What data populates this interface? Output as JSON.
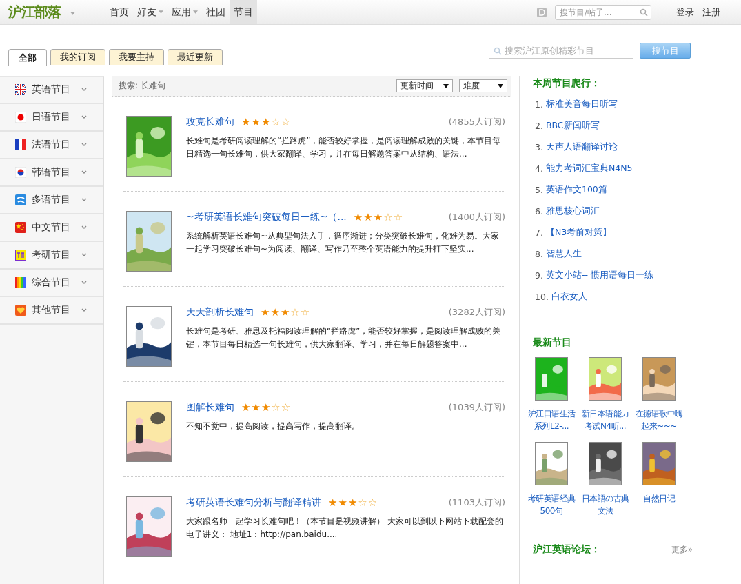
{
  "header": {
    "logo": "沪江部落",
    "nav": [
      {
        "label": "首页",
        "dropdown": false,
        "selected": false
      },
      {
        "label": "好友",
        "dropdown": true,
        "selected": false
      },
      {
        "label": "应用",
        "dropdown": true,
        "selected": false
      },
      {
        "label": "社团",
        "dropdown": false,
        "selected": false
      },
      {
        "label": "节目",
        "dropdown": false,
        "selected": true
      }
    ],
    "search": {
      "placeholder": "搜节目/帖子..."
    },
    "links": [
      "登录",
      "注册"
    ]
  },
  "tabs": [
    {
      "label": "全部",
      "selected": true
    },
    {
      "label": "我的订阅",
      "selected": false
    },
    {
      "label": "我要主持",
      "selected": false
    },
    {
      "label": "最近更新",
      "selected": false
    }
  ],
  "program_search": {
    "placeholder": "搜索沪江原创精彩节目",
    "button": "搜节目"
  },
  "sidebar": {
    "items": [
      {
        "label": "英语节目"
      },
      {
        "label": "日语节目"
      },
      {
        "label": "法语节目"
      },
      {
        "label": "韩语节目"
      },
      {
        "label": "多语节目"
      },
      {
        "label": "中文节目"
      },
      {
        "label": "考研节目"
      },
      {
        "label": "综合节目"
      },
      {
        "label": "其他节目"
      }
    ]
  },
  "results": {
    "query": "搜索: 长难句",
    "sort": "更新时间",
    "filter": "难度",
    "items": [
      {
        "title": "攻克长难句",
        "stars": 3,
        "subscribers": "(4855人订阅)",
        "description": "长难句是考研阅读理解的“拦路虎”，能否较好掌握，是阅读理解成败的关键，本节目每日精选一句长难句，供大家翻译、学习，并在每日解题答案中从结构、语法..."
      },
      {
        "title": "~考研英语长难句突破每日一练~（...",
        "stars": 3,
        "subscribers": "(1400人订阅)",
        "description": "系统解析英语长难句~从典型句法入手，循序渐进；分类突破长难句，化难为易。大家一起学习突破长难句~为阅读、翻译、写作乃至整个英语能力的提升打下坚实..."
      },
      {
        "title": "天天剖析长难句",
        "stars": 3,
        "subscribers": "(3282人订阅)",
        "description": "长难句是考研、雅思及托福阅读理解的“拦路虎”，能否较好掌握，是阅读理解成败的关键，本节目每日精选一句长难句，供大家翻译、学习，并在每日解题答案中..."
      },
      {
        "title": "图解长难句",
        "stars": 3,
        "subscribers": "(1039人订阅)",
        "description": "不知不觉中，提高阅读，提高写作，提高翻译。"
      },
      {
        "title": "考研英语长难句分析与翻译精讲",
        "stars": 3,
        "subscribers": "(1103人订阅)",
        "description": "大家跟名师一起学习长难句吧！（本节目是视频讲解） 大家可以到以下网站下载配套的电子讲义： 地址1：http://pan.baidu...."
      }
    ]
  },
  "ranking": {
    "title": "本周节目爬行：",
    "items": [
      {
        "rank": "1.",
        "name": "标准美音每日听写"
      },
      {
        "rank": "2.",
        "name": "BBC新闻听写"
      },
      {
        "rank": "3.",
        "name": "天声人语翻译讨论"
      },
      {
        "rank": "4.",
        "name": "能力考词汇宝典N4N5"
      },
      {
        "rank": "5.",
        "name": "英语作文100篇"
      },
      {
        "rank": "6.",
        "name": "雅思核心词汇"
      },
      {
        "rank": "7.",
        "name": "【N3考前对策】"
      },
      {
        "rank": "8.",
        "name": "智慧人生"
      },
      {
        "rank": "9.",
        "name": "英文小站-- 惯用语每日一练"
      },
      {
        "rank": "10.",
        "name": "白衣女人"
      }
    ]
  },
  "newest": {
    "title": "最新节目",
    "items": [
      {
        "name": "沪江口语生活系列L2-..."
      },
      {
        "name": "新日本语能力考试N4听..."
      },
      {
        "name": "在德语歌中嗨起来~~~"
      },
      {
        "name": "考研英语经典500句"
      },
      {
        "name": "日本語の古典文法"
      },
      {
        "name": "自然日记"
      }
    ]
  },
  "forum": {
    "title": "沪江英语论坛：",
    "more": "更多»"
  }
}
